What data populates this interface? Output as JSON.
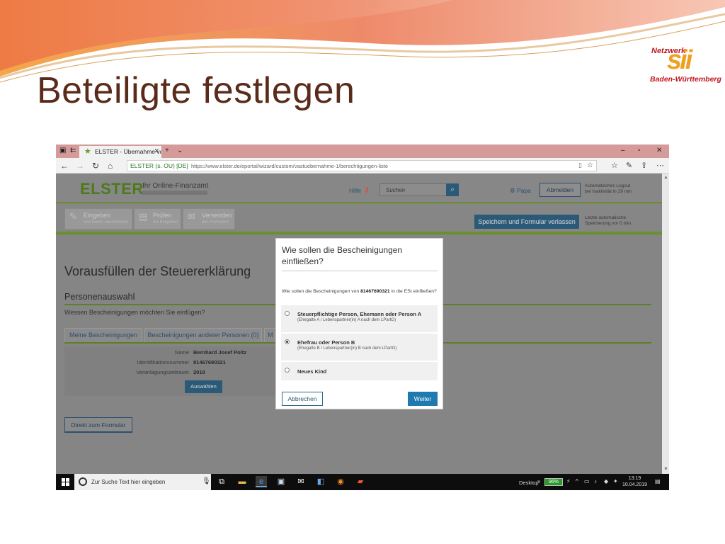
{
  "slide": {
    "title": "Beteiligte festlegen",
    "logo": {
      "top": "Netzwerk",
      "mark": "sii",
      "bottom": "Baden-Württemberg"
    }
  },
  "browser": {
    "tab_title": "ELSTER - Übernahme vc",
    "site_identity": "ELSTER (s. OU) [DE]",
    "url": "https://www.elster.de/eportal/wizard/custom/vastuebernahme-1/berechtigungen-liste"
  },
  "elster": {
    "logo": "ELSTER",
    "subtitle": "Ihr Online-Finanzamt",
    "help": "Hilfe",
    "search_placeholder": "Suchen",
    "user": "Papa",
    "logout_button": "Abmelden",
    "logout_note_1": "Automatisches Logout",
    "logout_note_2": "bei Inaktivität in 29 min",
    "steps": [
      {
        "label": "Eingeben",
        "sub": "und Daten übernehmen"
      },
      {
        "label": "Prüfen",
        "sub": "die Eingaben"
      },
      {
        "label": "Versenden",
        "sub": "des Formulars"
      }
    ],
    "save_button": "Speichern und Formular verlassen",
    "save_note_1": "Letzte automatische",
    "save_note_2": "Speicherung vor 0 min",
    "page_title": "Vorausfüllen der Steuererklärung",
    "section_title": "Personenauswahl",
    "section_question": "Wessen Bescheinigungen möchten Sie einfügen?",
    "subtabs": [
      "Meine Bescheinigungen",
      "Bescheinigungen anderer Personen (0)",
      "M"
    ],
    "info": [
      {
        "key": "Name",
        "value": "Bernhard Josef Poltz"
      },
      {
        "key": "Identifikationsnummer",
        "value": "81467690321"
      },
      {
        "key": "Veranlagungszeitraum",
        "value": "2018"
      }
    ],
    "select_button": "Auswählen",
    "direct_button": "Direkt zum Formular"
  },
  "modal": {
    "title": "Wie sollen die Bescheinigungen einfließen?",
    "question_pre": "Wie sollen die Bescheinigungen von ",
    "question_id": "81467690321",
    "question_post": " in die ESt einfließen?",
    "options": [
      {
        "label": "Steuerpflichtige Person, Ehemann oder Person A",
        "sub": "(Ehegatte A / Lebenspartner(in) A nach dem LPartG)",
        "selected": false
      },
      {
        "label": "Ehefrau oder Person B",
        "sub": "(Ehegatte B / Lebenspartner(in) B nach dem LPartG)",
        "selected": true
      },
      {
        "label": "Neues Kind",
        "sub": "",
        "selected": false
      }
    ],
    "cancel_button": "Abbrechen",
    "next_button": "Weiter"
  },
  "taskbar": {
    "search_text": "Zur Suche Text hier eingeben",
    "desktop_label": "Desktop",
    "battery": "96%",
    "time": "13:19",
    "date": "10.04.2019"
  },
  "colors": {
    "slide_title": "#5a2a1a",
    "elster_green": "#4e7a1c",
    "elster_blue": "#2b5a78",
    "tabbar": "#d59a9a"
  }
}
